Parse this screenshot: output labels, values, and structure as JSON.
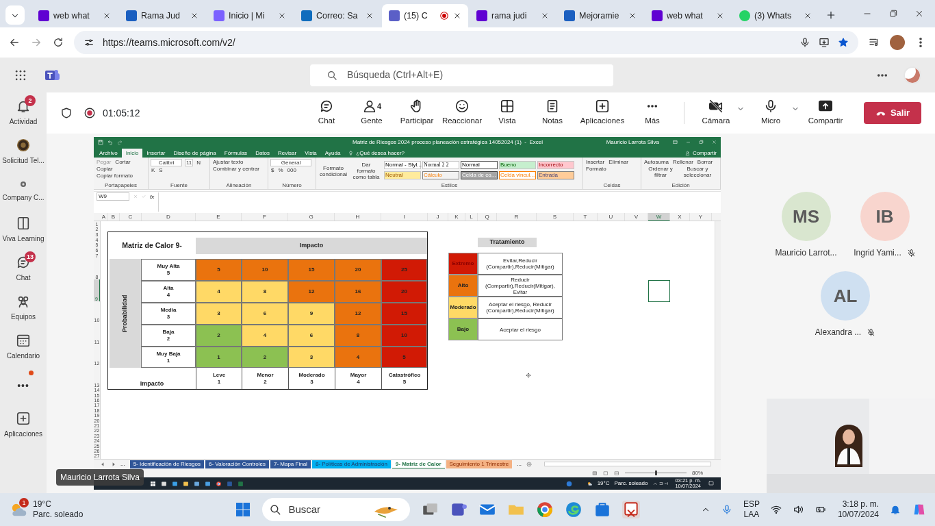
{
  "browser": {
    "tabs": [
      {
        "title": "web what",
        "selected": false,
        "recording": false
      },
      {
        "title": "Rama Jud",
        "selected": false,
        "recording": false
      },
      {
        "title": "Inicio | Mi",
        "selected": false,
        "recording": false
      },
      {
        "title": "Correo: Sa",
        "selected": false,
        "recording": false
      },
      {
        "title": "(15) C",
        "selected": true,
        "recording": true
      },
      {
        "title": "rama judi",
        "selected": false,
        "recording": false
      },
      {
        "title": "Mejoramie",
        "selected": false,
        "recording": false
      },
      {
        "title": "web what",
        "selected": false,
        "recording": false
      },
      {
        "title": "(3) Whats",
        "selected": false,
        "recording": false
      }
    ],
    "url": "https://teams.microsoft.com/v2/"
  },
  "teams": {
    "search_placeholder": "Búsqueda (Ctrl+Alt+E)",
    "rail": [
      {
        "label": "Actividad",
        "badge": "2"
      },
      {
        "label": "Solicitud Tel..."
      },
      {
        "label": "Company C..."
      },
      {
        "label": "Viva Learning"
      },
      {
        "label": "Chat",
        "badge": "13"
      },
      {
        "label": "Equipos"
      },
      {
        "label": "Calendario"
      },
      {
        "label": "•••",
        "dot": true
      },
      {
        "label": "Aplicaciones"
      }
    ]
  },
  "meeting": {
    "timer": "01:05:12",
    "controls": [
      {
        "label": "Chat"
      },
      {
        "label": "Gente",
        "count": "4"
      },
      {
        "label": "Participar"
      },
      {
        "label": "Reaccionar"
      },
      {
        "label": "Vista"
      },
      {
        "label": "Notas"
      },
      {
        "label": "Aplicaciones"
      },
      {
        "label": "Más"
      }
    ],
    "devices": [
      {
        "label": "Cámara",
        "on": false
      },
      {
        "label": "Micro",
        "on": true
      },
      {
        "label": "Compartir"
      }
    ],
    "leave": "Salir"
  },
  "excel": {
    "title": "Matriz de Riesgos 2024 proceso planeación estratégica 14052024 (1)  -  Excel",
    "user": "Mauricio Larrota Silva",
    "tabs": [
      {
        "label": "Archivo",
        "selected": false
      },
      {
        "label": "Inicio",
        "selected": true
      },
      {
        "label": "Insertar",
        "selected": false
      },
      {
        "label": "Diseño de página",
        "selected": false
      },
      {
        "label": "Fórmulas",
        "selected": false
      },
      {
        "label": "Datos",
        "selected": false
      },
      {
        "label": "Revisar",
        "selected": false
      },
      {
        "label": "Vista",
        "selected": false
      },
      {
        "label": "Ayuda",
        "selected": false
      }
    ],
    "tell_me": "¿Qué desea hacer?",
    "share": "Compartir",
    "ribbon": [
      {
        "label": "Portapapeles",
        "items": [
          "Pegar",
          "Cortar",
          "Copiar",
          "Copiar formato"
        ]
      },
      {
        "label": "Fuente",
        "items": [
          "Calibri",
          "11",
          "N",
          "K",
          "S"
        ]
      },
      {
        "label": "Alineación",
        "items": [
          "Ajustar texto",
          "Combinar y centrar"
        ]
      },
      {
        "label": "Número",
        "items": [
          "General",
          "$",
          "%",
          "000"
        ]
      },
      {
        "label": "Estilos",
        "items": [
          "Formato condicional",
          "Dar formato como tabla"
        ],
        "styles": [
          {
            "text": "Normal - Styl...",
            "kind": "normal"
          },
          {
            "text": "Normal 2 2",
            "kind": "serif"
          },
          {
            "text": "Normal",
            "kind": "boxed"
          },
          {
            "text": "Bueno",
            "kind": "good"
          },
          {
            "text": "Incorrecto",
            "kind": "bad"
          },
          {
            "text": "Neutral",
            "kind": "neutral"
          },
          {
            "text": "Cálculo",
            "kind": "calculation"
          },
          {
            "text": "Celda de co...",
            "kind": "check"
          },
          {
            "text": "Celda vincul...",
            "kind": "linked"
          },
          {
            "text": "Entrada",
            "kind": "input"
          }
        ]
      },
      {
        "label": "Celdas",
        "items": [
          "Insertar",
          "Eliminar",
          "Formato"
        ]
      },
      {
        "label": "Edición",
        "items": [
          "Autosuma",
          "Rellenar",
          "Borrar",
          "Ordenar y filtrar",
          "Buscar y seleccionar"
        ]
      }
    ],
    "name_box": "W9",
    "fx": "fx",
    "columns": [
      {
        "label": "A",
        "selected": false
      },
      {
        "label": "B",
        "selected": false
      },
      {
        "label": "C",
        "selected": false
      },
      {
        "label": "D",
        "selected": false
      },
      {
        "label": "E",
        "selected": false
      },
      {
        "label": "F",
        "selected": false
      },
      {
        "label": "G",
        "selected": false
      },
      {
        "label": "H",
        "selected": false
      },
      {
        "label": "I",
        "selected": false
      },
      {
        "label": "J",
        "selected": false
      },
      {
        "label": "K",
        "selected": false
      },
      {
        "label": "L",
        "selected": false
      },
      {
        "label": "Q",
        "selected": false
      },
      {
        "label": "R",
        "selected": false
      },
      {
        "label": "S",
        "selected": false
      },
      {
        "label": "T",
        "selected": false
      },
      {
        "label": "U",
        "selected": false
      },
      {
        "label": "V",
        "selected": false
      },
      {
        "label": "W",
        "selected": true
      },
      {
        "label": "X",
        "selected": false
      },
      {
        "label": "Y",
        "selected": false
      }
    ],
    "rows": [
      {
        "label": "1",
        "selected": false
      },
      {
        "label": "2",
        "selected": false
      },
      {
        "label": "3",
        "selected": false
      },
      {
        "label": "4",
        "selected": false
      },
      {
        "label": "5",
        "selected": false
      },
      {
        "label": "6",
        "selected": false
      },
      {
        "label": "7",
        "selected": false
      },
      {
        "label": "8",
        "selected": false
      },
      {
        "label": "9",
        "selected": true
      },
      {
        "label": "10",
        "selected": false
      },
      {
        "label": "11",
        "selected": false
      },
      {
        "label": "12",
        "selected": false
      },
      {
        "label": "13",
        "selected": false
      },
      {
        "label": "14",
        "selected": false
      },
      {
        "label": "15",
        "selected": false
      },
      {
        "label": "16",
        "selected": false
      },
      {
        "label": "17",
        "selected": false
      },
      {
        "label": "18",
        "selected": false
      },
      {
        "label": "19",
        "selected": false
      },
      {
        "label": "20",
        "selected": false
      },
      {
        "label": "21",
        "selected": false
      },
      {
        "label": "22",
        "selected": false
      },
      {
        "label": "23",
        "selected": false
      },
      {
        "label": "24",
        "selected": false
      },
      {
        "label": "25",
        "selected": false
      },
      {
        "label": "26",
        "selected": false
      },
      {
        "label": "27",
        "selected": false
      }
    ],
    "matrix": {
      "title": "Matriz de Calor 9-",
      "impact_header": "Impacto",
      "probability_header": "Probabilidad",
      "impact_footer": "Impacto",
      "rows": [
        {
          "label": "Muy Alta",
          "value": "5",
          "cells": [
            {
              "text": "5",
              "color": "#ea730e"
            },
            {
              "text": "10",
              "color": "#ea730e"
            },
            {
              "text": "15",
              "color": "#ea730e"
            },
            {
              "text": "20",
              "color": "#ea730e"
            },
            {
              "text": "25",
              "color": "#d11a05"
            }
          ]
        },
        {
          "label": "Alta",
          "value": "4",
          "cells": [
            {
              "text": "4",
              "color": "#ffd966"
            },
            {
              "text": "8",
              "color": "#ffd966"
            },
            {
              "text": "12",
              "color": "#ea730e"
            },
            {
              "text": "16",
              "color": "#ea730e"
            },
            {
              "text": "20",
              "color": "#d11a05"
            }
          ]
        },
        {
          "label": "Media",
          "value": "3",
          "cells": [
            {
              "text": "3",
              "color": "#ffd966"
            },
            {
              "text": "6",
              "color": "#ffd966"
            },
            {
              "text": "9",
              "color": "#ffd966"
            },
            {
              "text": "12",
              "color": "#ea730e"
            },
            {
              "text": "15",
              "color": "#d11a05"
            }
          ]
        },
        {
          "label": "Baja",
          "value": "2",
          "cells": [
            {
              "text": "2",
              "color": "#8cc152"
            },
            {
              "text": "4",
              "color": "#ffd966"
            },
            {
              "text": "6",
              "color": "#ffd966"
            },
            {
              "text": "8",
              "color": "#ea730e"
            },
            {
              "text": "10",
              "color": "#d11a05"
            }
          ]
        },
        {
          "label": "Muy Baja",
          "value": "1",
          "cells": [
            {
              "text": "1",
              "color": "#8cc152"
            },
            {
              "text": "2",
              "color": "#8cc152"
            },
            {
              "text": "3",
              "color": "#ffd966"
            },
            {
              "text": "4",
              "color": "#ea730e"
            },
            {
              "text": "5",
              "color": "#d11a05"
            }
          ]
        }
      ],
      "impact_levels": [
        {
          "label": "Leve",
          "value": "1"
        },
        {
          "label": "Menor",
          "value": "2"
        },
        {
          "label": "Moderado",
          "value": "3"
        },
        {
          "label": "Mayor",
          "value": "4"
        },
        {
          "label": "Catastrófico",
          "value": "5"
        }
      ]
    },
    "treatment": {
      "title": "Tratamiento",
      "rows": [
        {
          "label": "Extremo",
          "color": "#d11a05",
          "text": "Evitar,Reducir (Compartir),Reducir(Mitigar)"
        },
        {
          "label": "Alto",
          "color": "#ea730e",
          "text": "Reducir (Compartir),Reducir(Mitigar), Evitar"
        },
        {
          "label": "Moderado",
          "color": "#ffd966",
          "text": "Aceptar el riesgo, Reducir (Compartir),Reducir(Mitigar)"
        },
        {
          "label": "Bajo",
          "color": "#8cc152",
          "text": "Aceptar el riesgo"
        }
      ]
    },
    "sheet_more": "...",
    "sheets": [
      {
        "label": "5- Identificación de Riesgos",
        "color": "#2f5597",
        "selected": false
      },
      {
        "label": "6- Valoración Controles",
        "color": "#2f5597",
        "selected": false
      },
      {
        "label": "7- Mapa Final",
        "color": "#2f5597",
        "selected": false
      },
      {
        "label": "8- Políticas de Administración",
        "color": "#00b0f0",
        "selected": false
      },
      {
        "label": "9- Matriz de Calor",
        "color": "#ffffff",
        "selected": true
      },
      {
        "label": "Seguimiento 1 Trimestre",
        "color": "#f4b183",
        "selected": false
      }
    ],
    "sheets_more": "...",
    "zoom_slider": {
      "level": 0.5
    },
    "zoom": "80%",
    "remote_taskbar": {
      "temp": "19°C",
      "condition": "Parc. soleado",
      "time": "03:21 p. m.",
      "date": "10/07/2024"
    }
  },
  "presenter_tag": "Mauricio Larrota Silva",
  "participants": [
    {
      "initials": "MS",
      "name": "Mauricio Larrot...",
      "color": "#d9e6cf",
      "muted": false
    },
    {
      "initials": "IB",
      "name": "Ingrid Yami...",
      "color": "#f8d5ce",
      "muted": true
    },
    {
      "initials": "AL",
      "name": "Alexandra ...",
      "color": "#cfe0f1",
      "muted": true
    }
  ],
  "taskbar": {
    "weather_badge": "1",
    "temp": "19°C",
    "condition": "Parc. soleado",
    "search": "Buscar",
    "lang": "ESP",
    "region": "LAA",
    "time": "3:18 p. m.",
    "date": "10/07/2024"
  }
}
